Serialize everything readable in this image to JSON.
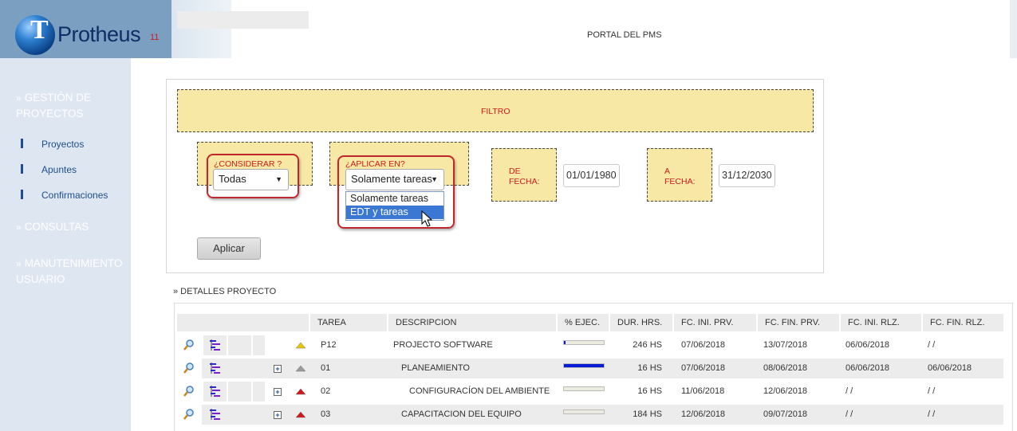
{
  "header": {
    "logo_name": "Protheus",
    "logo_version": "11",
    "portal_title": "PORTAL DEL PMS"
  },
  "sidebar": {
    "sections": [
      {
        "label": "GESTIÓN DE PROYECTOS"
      },
      {
        "label": "CONSULTAS"
      },
      {
        "label": "MANUTENIMIENTO USUARIO"
      }
    ],
    "links": [
      "Proyectos",
      "Apuntes",
      "Confirmaciones"
    ]
  },
  "filter": {
    "title": "FILTRO",
    "considerar_label": "¿CONSIDERAR ?",
    "considerar_value": "Todas",
    "aplicar_label": "¿APLICAR EN?",
    "aplicar_value": "Solamente tareas",
    "aplicar_options": [
      "Solamente tareas",
      "EDT y tareas"
    ],
    "aplicar_highlighted": "EDT y tareas",
    "de_fecha_label_1": "DE",
    "de_fecha_label_2": "FECHA:",
    "de_fecha_value": "01/01/1980",
    "a_fecha_label_1": "A",
    "a_fecha_label_2": "FECHA:",
    "a_fecha_value": "31/12/2030",
    "apply_button": "Aplicar"
  },
  "details": {
    "section_label": "» DETALLES PROYECTO",
    "columns": [
      "TAREA",
      "DESCRIPCION",
      "% EJEC.",
      "DUR. HRS.",
      "FC. INI. PRV.",
      "FC. FIN. PRV.",
      "FC. INI. RLZ.",
      "FC. FIN. RLZ."
    ],
    "rows": [
      {
        "tarea": "P12",
        "descripcion": "PROJECTO SOFTWARE",
        "progress": 0.04,
        "dur": "246 HS",
        "ini_prv": "07/06/2018",
        "fin_prv": "13/07/2018",
        "ini_rlz": "06/06/2018",
        "fin_rlz": "/ /",
        "flag_color": "#e8c800",
        "expandable": false
      },
      {
        "tarea": "01",
        "descripcion": "PLANEAMIENTO",
        "progress": 1.0,
        "dur": "16 HS",
        "ini_prv": "07/06/2018",
        "fin_prv": "08/06/2018",
        "ini_rlz": "06/06/2018",
        "fin_rlz": "06/06/2018",
        "flag_color": "#9a9a9a",
        "expandable": true
      },
      {
        "tarea": "02",
        "descripcion": "CONFIGURACÍON DEL AMBIENTE",
        "progress": 0.0,
        "dur": "16 HS",
        "ini_prv": "11/06/2018",
        "fin_prv": "12/06/2018",
        "ini_rlz": "/ /",
        "fin_rlz": "/ /",
        "flag_color": "#d01818",
        "expandable": true
      },
      {
        "tarea": "03",
        "descripcion": "CAPACITACION DEL EQUIPO",
        "progress": 0.0,
        "dur": "184 HS",
        "ini_prv": "12/06/2018",
        "fin_prv": "09/07/2018",
        "ini_rlz": "/ /",
        "fin_rlz": "/ /",
        "flag_color": "#d01818",
        "expandable": true
      }
    ]
  }
}
